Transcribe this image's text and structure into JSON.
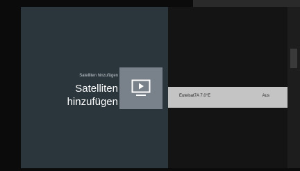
{
  "info": {
    "subtitle": "Satelliten hinzufügen",
    "title": "Satelliten hinzufügen",
    "icon": "tv-play-icon"
  },
  "list": {
    "items": [
      {
        "label": "Eutelsat7A 7.0°E",
        "value": "Aus",
        "selected": true
      }
    ]
  },
  "colors": {
    "info_panel": "#2a353c",
    "tile": "#79828a",
    "selected_row": "#c4c4c4"
  }
}
